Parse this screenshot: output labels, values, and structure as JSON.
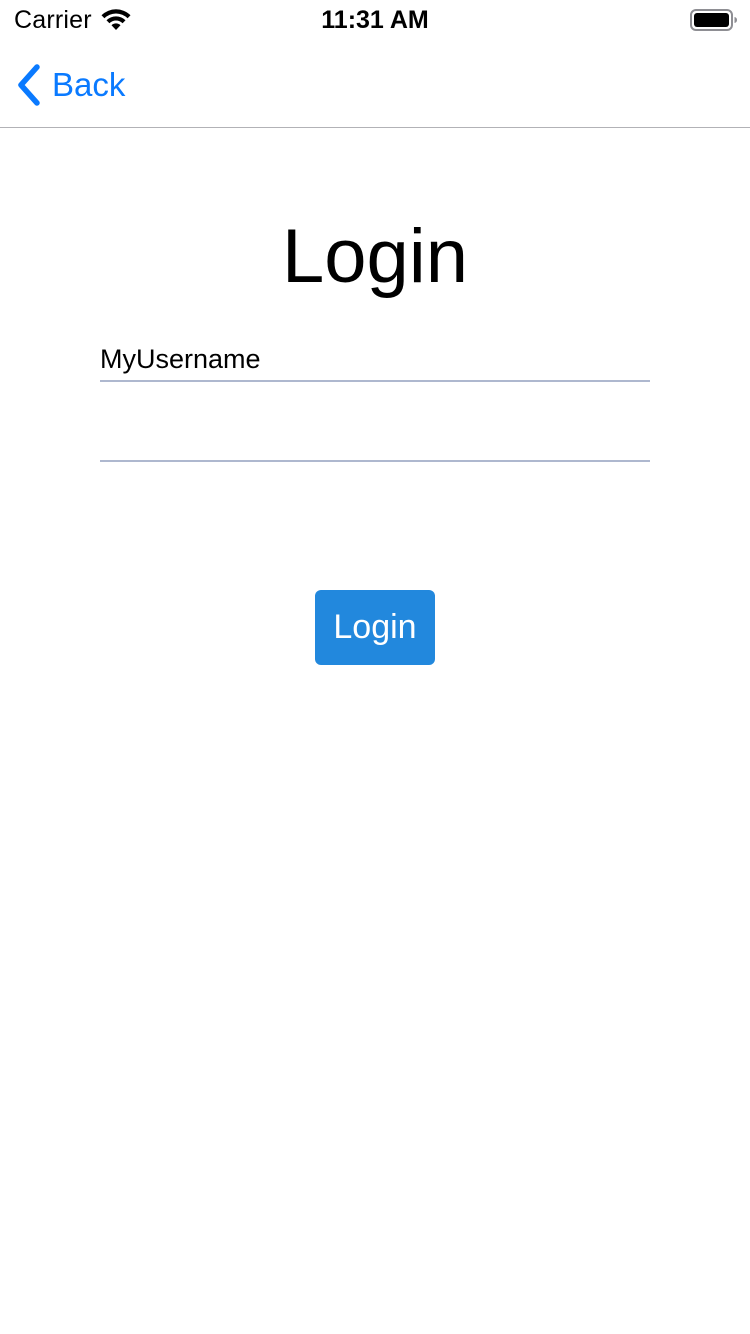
{
  "status_bar": {
    "carrier": "Carrier",
    "time": "11:31 AM",
    "wifi_icon": "wifi-icon",
    "battery_icon": "battery-icon"
  },
  "nav": {
    "back_label": "Back",
    "back_icon": "chevron-left-icon"
  },
  "login": {
    "title": "Login",
    "username_value": "MyUsername",
    "password_value": "",
    "button_label": "Login"
  },
  "colors": {
    "accent": "#0a7aff",
    "button_bg": "#2288dd",
    "field_underline": "#aeb8cf",
    "divider": "#b2b2b6"
  }
}
